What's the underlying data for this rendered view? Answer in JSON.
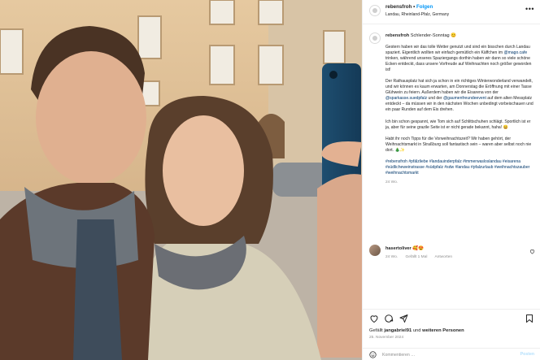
{
  "post": {
    "username": "rebensfroh",
    "follow_label": "Folgen",
    "location": "Landau, Rheinland-Pfalz, Germany"
  },
  "caption": {
    "username": "rebensfroh",
    "title": "Schlender-Sonntag 😊",
    "p1": {
      "a": "Gestern haben wir das tolle Wetter genutzt und sind ein bisschen durch Landau spaziert. Eigentlich wollten wir einfach gemütlich ein Käffchen im ",
      "mention": "@mago.cafe",
      "b": " trinken, während unseres Spaziergangs dorthin haben wir dann so viele schöne Ecken entdeckt, dass unsere Vorfreude auf Weihnachten noch größer geworden ist!"
    },
    "p2": {
      "a": "Der Rathausplatz hat sich ja schon in ein richtiges Winterwonderland verwandelt, und wir können es kaum erwarten, am Donnerstag die Eröffnung mit einer Tasse Glühwein zu feiern. Außerdem haben wir die Eisarena von der ",
      "mention1": "@sparkasse.suedpfalz",
      "b": " und der ",
      "mention2": "@gaumenfreundeevent",
      "c": " auf dem alten Messplatz entdeckt – da müssen wir in den nächsten Wochen unbedingt vorbeischauen und ein paar Runden auf dem Eis drehen."
    },
    "p3": "Ich bin schon gespannt, wie Tom sich auf Schlittschuhen schlägt. Sportlich ist er ja, aber für seine grazile Seite ist er nicht gerade bekannt, haha! 😄",
    "p4": "Habt ihr noch Tipps für die Vorweihnachtszeit? Wir haben gehört, der Weihnachtsmarkt in Straßburg soll fantastisch sein – waren aber selbst noch nie dort. 🎄✨",
    "hashtags": "#rebensfroh #pfälzliebe #landauinderpfalz #immerwasloslandau #eisarena #südlicheweinstrasse #südpfalz #sdw #landau #pfalzurlaub #weihnachtszauber #weihnachtsmarkt",
    "time": "24 Wo."
  },
  "comment": {
    "username": "hasertoliver",
    "text": "🥰😍",
    "time": "24 Wo.",
    "likes": "Gefällt 1 Mal",
    "reply_label": "Antworten"
  },
  "actions": {
    "likes_prefix": "Gefällt ",
    "likes_user": "jangabriel91",
    "likes_mid": " und ",
    "likes_suffix": "weiteren Personen",
    "date": "25. November 2024"
  },
  "add_comment": {
    "placeholder": "Kommentieren …",
    "post_label": "Posten"
  },
  "icons": [
    "more-icon",
    "heart-icon",
    "comment-icon",
    "share-icon",
    "bookmark-icon",
    "emoji-icon"
  ],
  "colors": {
    "follow": "#0095f6",
    "mention": "#00376b",
    "meta": "#8e8e8e",
    "border": "#efefef"
  }
}
